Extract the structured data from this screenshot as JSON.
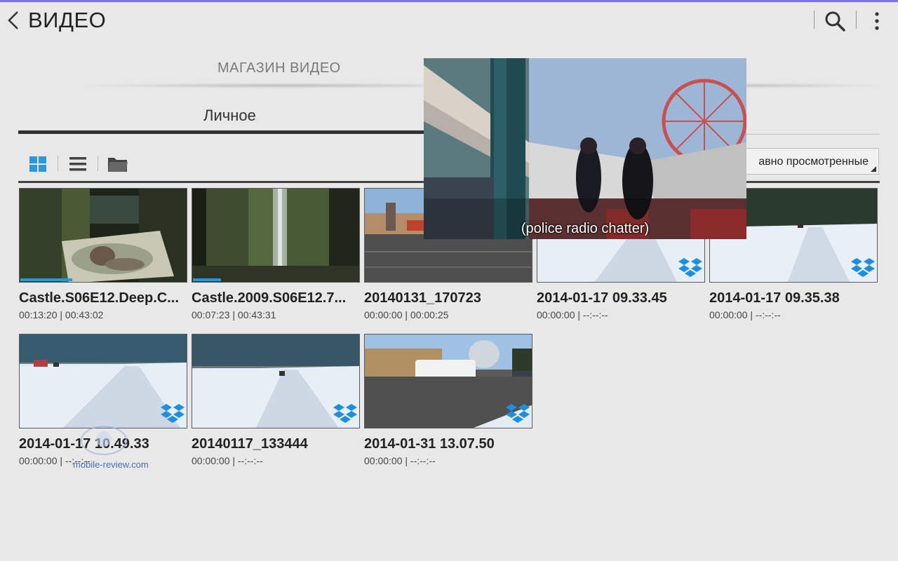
{
  "header": {
    "title": "ВИДЕО",
    "back_icon": "back-chevron-icon",
    "search_icon": "search-icon",
    "more_icon": "more-vertical-icon"
  },
  "tabs": {
    "store": "МАГАЗИН ВИДЕО",
    "personal": "Личное"
  },
  "toolbar": {
    "view_icons": [
      "grid-view-icon",
      "list-view-icon",
      "folder-view-icon"
    ],
    "sort_label": "авно просмотренные"
  },
  "colors": {
    "accent_top": "#7b73e6",
    "progress": "#1e9be8",
    "dropbox": "#1e8ee0"
  },
  "videos": [
    {
      "title": "Castle.S06E12.Deep.C...",
      "time": "00:13:20 | 00:43:02",
      "progress": 0.31,
      "dropbox": false
    },
    {
      "title": "Castle.2009.S06E12.7...",
      "time": "00:07:23 | 00:43:31",
      "progress": 0.17,
      "dropbox": false
    },
    {
      "title": "20140131_170723",
      "time": "00:00:00 | 00:00:25",
      "progress": 0,
      "dropbox": false
    },
    {
      "title": "2014-01-17 09.33.45",
      "time": "00:00:00 | --:--:--",
      "progress": 0,
      "dropbox": true
    },
    {
      "title": "2014-01-17 09.35.38",
      "time": "00:00:00 | --:--:--",
      "progress": 0,
      "dropbox": true
    },
    {
      "title": "2014-01-17 10.49.33",
      "time": "00:00:00 | --:--:--",
      "progress": 0,
      "dropbox": true
    },
    {
      "title": "20140117_133444",
      "time": "00:00:00 | --:--:--",
      "progress": 0,
      "dropbox": true
    },
    {
      "title": "2014-01-31 13.07.50",
      "time": "00:00:00 | --:--:--",
      "progress": 0,
      "dropbox": true
    }
  ],
  "popup": {
    "subtitle": "(police radio chatter)"
  },
  "watermark": {
    "text": "mobile-review.com"
  }
}
